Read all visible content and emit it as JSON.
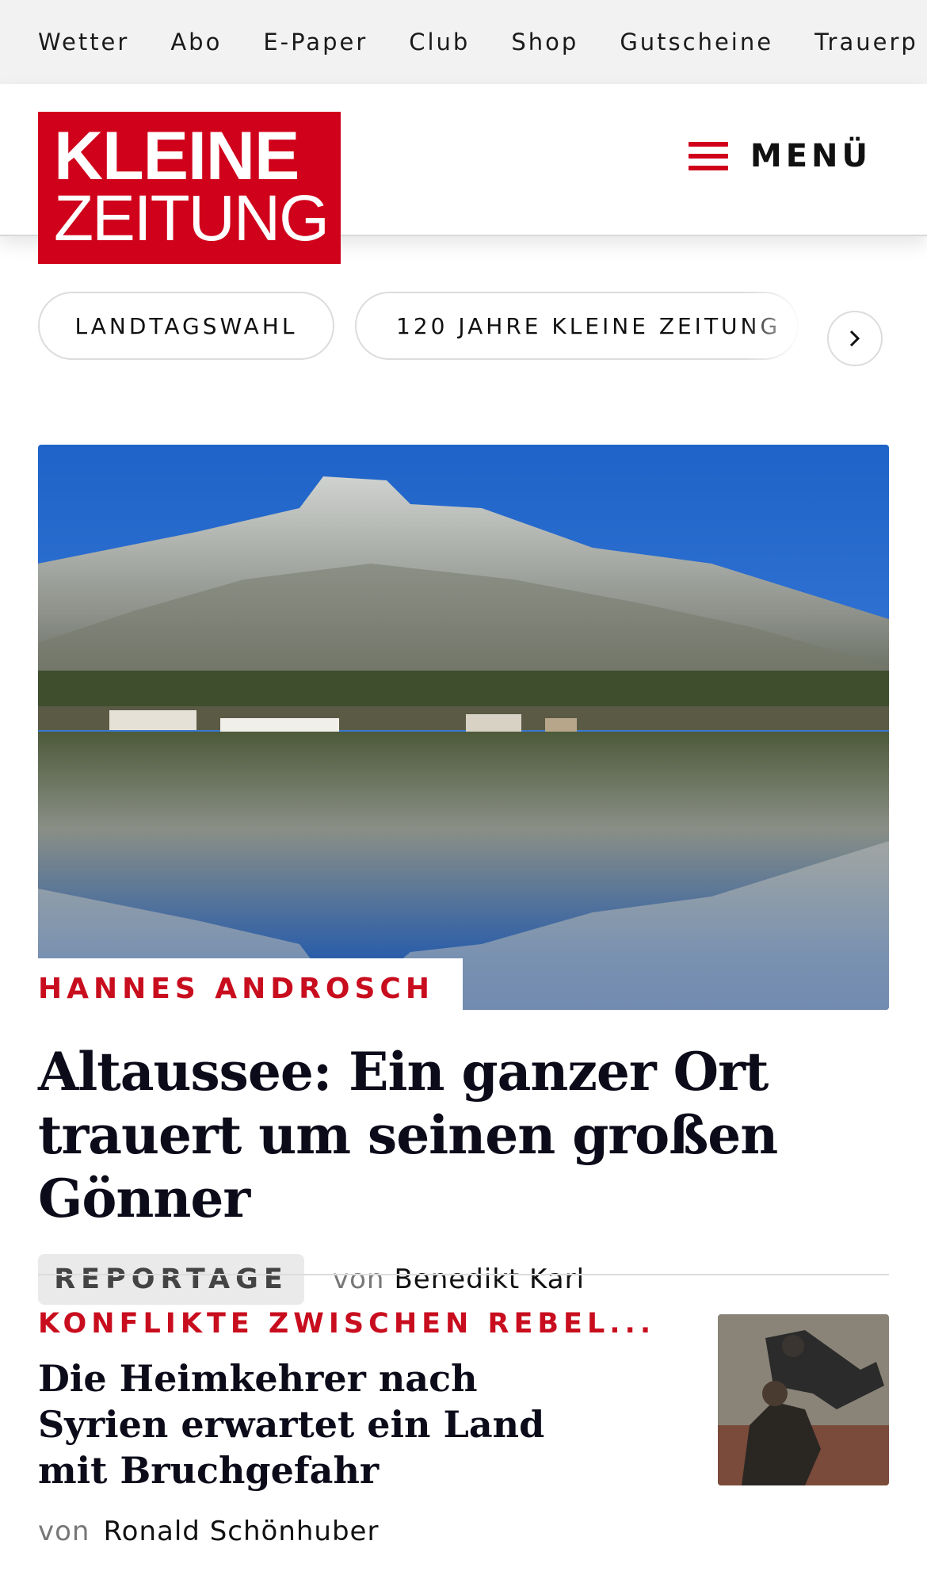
{
  "topnav": [
    "Wetter",
    "Abo",
    "E-Paper",
    "Club",
    "Shop",
    "Gutscheine",
    "Trauerp"
  ],
  "logo": {
    "line1": "KLEINE",
    "line2": "ZEITUNG"
  },
  "menu": {
    "label": "MENÜ",
    "icon": "hamburger-icon"
  },
  "chips": [
    "LANDTAGSWAHL",
    "120 JAHRE KLEINE ZEITUNG"
  ],
  "chips_next_icon": "chevron-right-icon",
  "hero": {
    "kicker": "HANNES ANDROSCH",
    "title": "Altaussee: Ein ganzer Ort trauert um seinen großen Gönner",
    "tag": "REPORTAGE",
    "by": "von",
    "author": "Benedikt Karl"
  },
  "article2": {
    "kicker": "KONFLIKTE ZWISCHEN REBEL...",
    "title": "Die Heimkehrer nach Syrien erwartet ein Land mit Bruchgefahr",
    "by": "von",
    "author": "Ronald Schönhuber"
  },
  "colors": {
    "brand_red": "#d0021b",
    "kicker_red": "#c80d1e",
    "topbar_bg": "#f2f2f2"
  }
}
